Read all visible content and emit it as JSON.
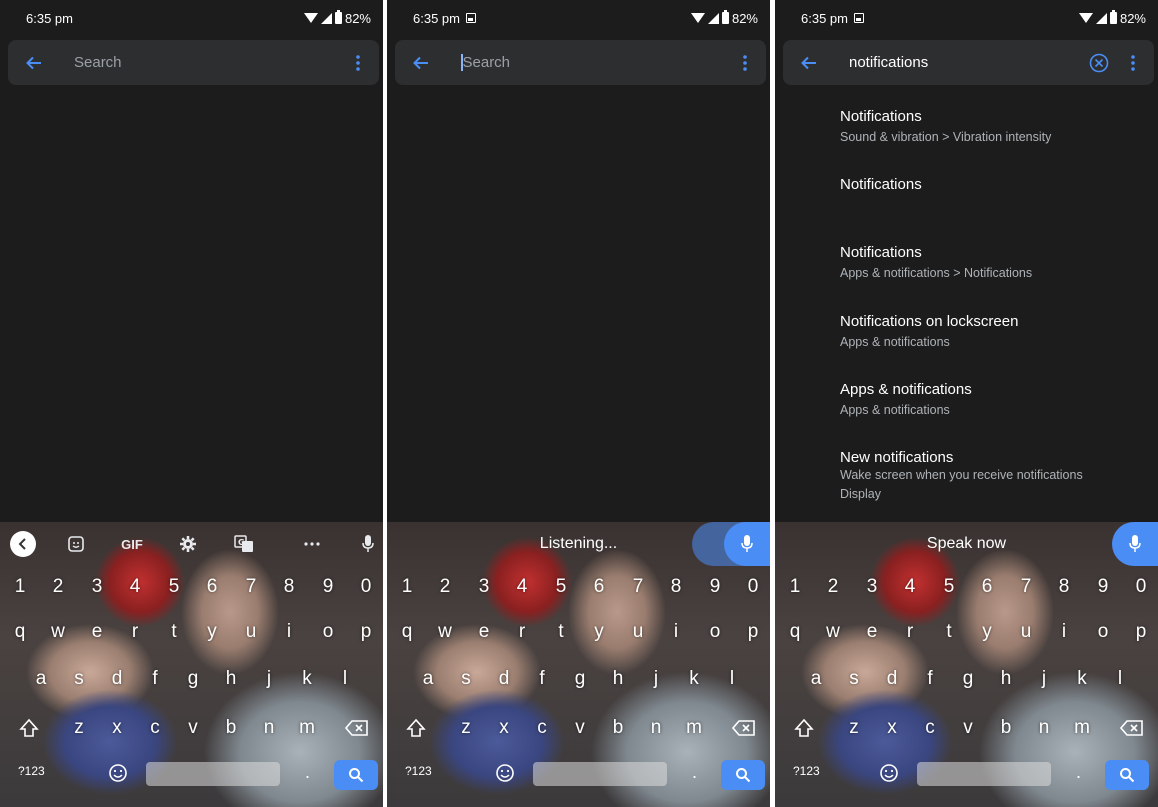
{
  "status": {
    "time": "6:35 pm",
    "battery": "82%"
  },
  "screens": [
    {
      "search_placeholder": "Search",
      "keyboard_mode": "toolbar",
      "toolbar": {
        "gif_label": "GIF"
      }
    },
    {
      "search_placeholder": "Search",
      "keyboard_mode": "voice",
      "voice_message": "Listening..."
    },
    {
      "search_query": "notifications",
      "keyboard_mode": "voice",
      "voice_message": "Speak now",
      "results": [
        {
          "title": "Notifications",
          "subtitle": "Sound & vibration > Vibration intensity"
        },
        {
          "title": "Notifications",
          "subtitle": ""
        },
        {
          "title": "Notifications",
          "subtitle": "Apps & notifications > Notifications"
        },
        {
          "title": "Notifications on lockscreen",
          "subtitle": "Apps & notifications"
        },
        {
          "title": "Apps & notifications",
          "subtitle": "Apps & notifications"
        },
        {
          "title": "New notifications",
          "subtitle": "Wake screen when you receive notifications",
          "subtitle2": "Display"
        }
      ]
    }
  ],
  "keyboard": {
    "numbers": [
      "1",
      "2",
      "3",
      "4",
      "5",
      "6",
      "7",
      "8",
      "9",
      "0"
    ],
    "row1": [
      "q",
      "w",
      "e",
      "r",
      "t",
      "y",
      "u",
      "i",
      "o",
      "p"
    ],
    "row2": [
      "a",
      "s",
      "d",
      "f",
      "g",
      "h",
      "j",
      "k",
      "l"
    ],
    "row3": [
      "z",
      "x",
      "c",
      "v",
      "b",
      "n",
      "m"
    ],
    "symbols_key": "?123",
    "period_key": "."
  },
  "colors": {
    "background": "#1c1c1c",
    "search_bar": "#2d2e30",
    "accent": "#4a8df5",
    "link_blue": "#8ab4f8"
  },
  "icons": {
    "back": "arrow-left-icon",
    "menu": "more-vertical-icon",
    "clear": "close-circle-icon",
    "mic": "mic-icon",
    "search": "search-icon",
    "backspace": "backspace-icon",
    "shift": "shift-icon",
    "emoji": "emoji-icon",
    "settings": "gear-icon",
    "sticker": "sticker-icon",
    "translate": "translate-icon"
  }
}
